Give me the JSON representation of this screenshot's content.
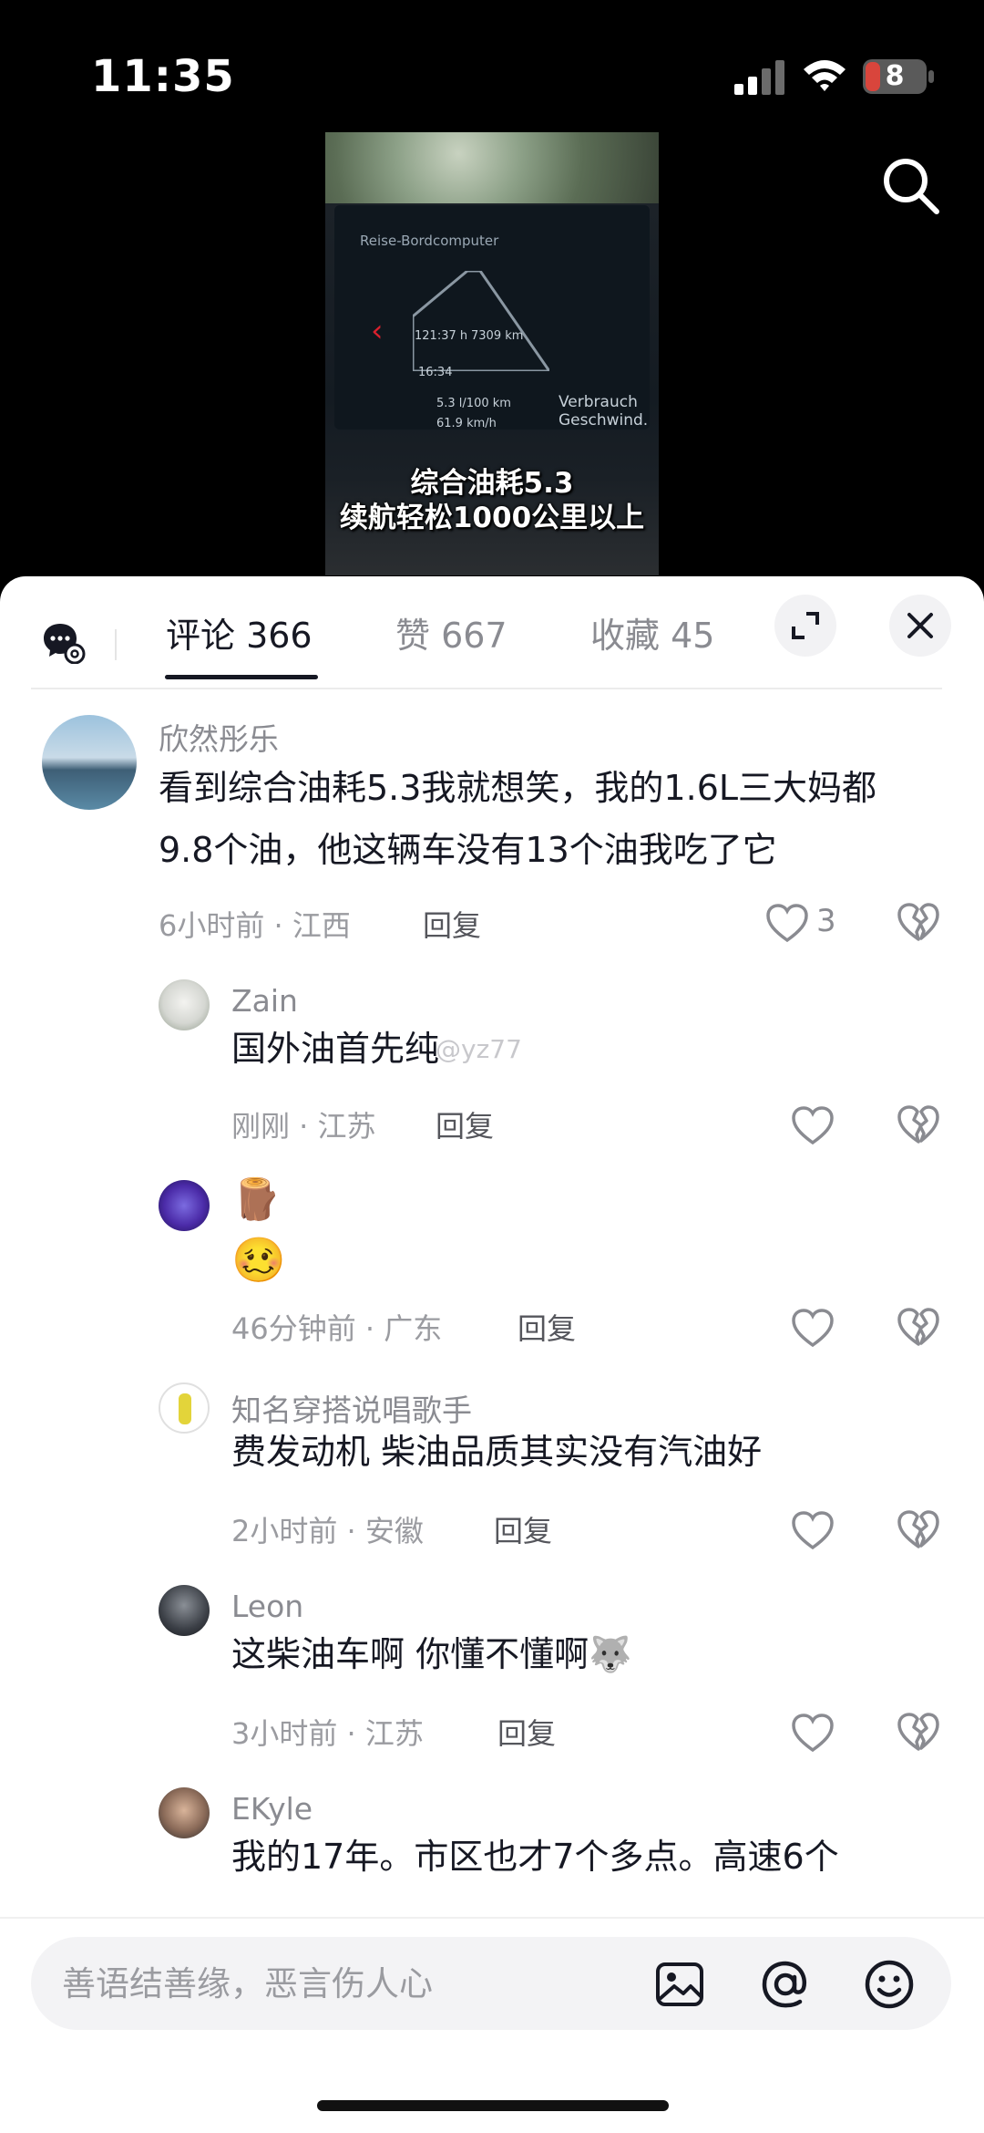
{
  "status_bar": {
    "time": "11:35",
    "battery_level": "8",
    "battery_color": "#d9453c"
  },
  "video": {
    "screen_title": "Reise-Bordcomputer",
    "trip_time": "121:37 h",
    "trip_distance": "7309 km",
    "clock": "16:34",
    "consumption_value": "5.3 l/100 km",
    "consumption_label": "Verbrauch",
    "speed_value": "61.9 km/h",
    "speed_label": "Geschwind.",
    "caption_line1": "综合油耗5.3",
    "caption_line2": "续航轻松1000公里以上"
  },
  "tabs": [
    {
      "label": "评论 366",
      "active": true
    },
    {
      "label": "赞 667",
      "active": false
    },
    {
      "label": "收藏 45",
      "active": false
    }
  ],
  "watermark": "@yz77",
  "comments": [
    {
      "author": "欣然彤乐",
      "lines": [
        "看到综合油耗5.3我就想笑，我的1.6L三大妈都",
        "9.8个油，他这辆车没有13个油我吃了它"
      ],
      "meta": "6小时前 · 江西",
      "reply": "回复",
      "likes": "3",
      "level": "top"
    },
    {
      "author": "Zain",
      "lines": [
        "国外油首先纯"
      ],
      "meta": "刚刚 · 江苏",
      "reply": "回复",
      "likes": "",
      "level": "reply"
    },
    {
      "author": "",
      "lines": [
        "🪵",
        "🥴"
      ],
      "meta": "46分钟前 · 广东",
      "reply": "回复",
      "likes": "",
      "level": "reply"
    },
    {
      "author": "知名穿搭说唱歌手",
      "lines": [
        "费发动机 柴油品质其实没有汽油好"
      ],
      "meta": "2小时前 · 安徽",
      "reply": "回复",
      "likes": "",
      "level": "reply"
    },
    {
      "author": "Leon",
      "lines": [
        "这柴油车啊 你懂不懂啊🐺"
      ],
      "meta": "3小时前 · 江苏",
      "reply": "回复",
      "likes": "",
      "level": "reply"
    },
    {
      "author": "EKyle",
      "lines": [
        "我的17年。市区也才7个多点。高速6个"
      ],
      "meta": "",
      "reply": "",
      "likes": "",
      "level": "reply"
    }
  ],
  "input": {
    "placeholder": "善语结善缘，恶言伤人心"
  },
  "icons": [
    "search-icon",
    "chat-settings-icon",
    "expand-icon",
    "close-icon",
    "heart-icon",
    "broken-heart-icon",
    "image-icon",
    "at-icon",
    "emoji-icon"
  ]
}
